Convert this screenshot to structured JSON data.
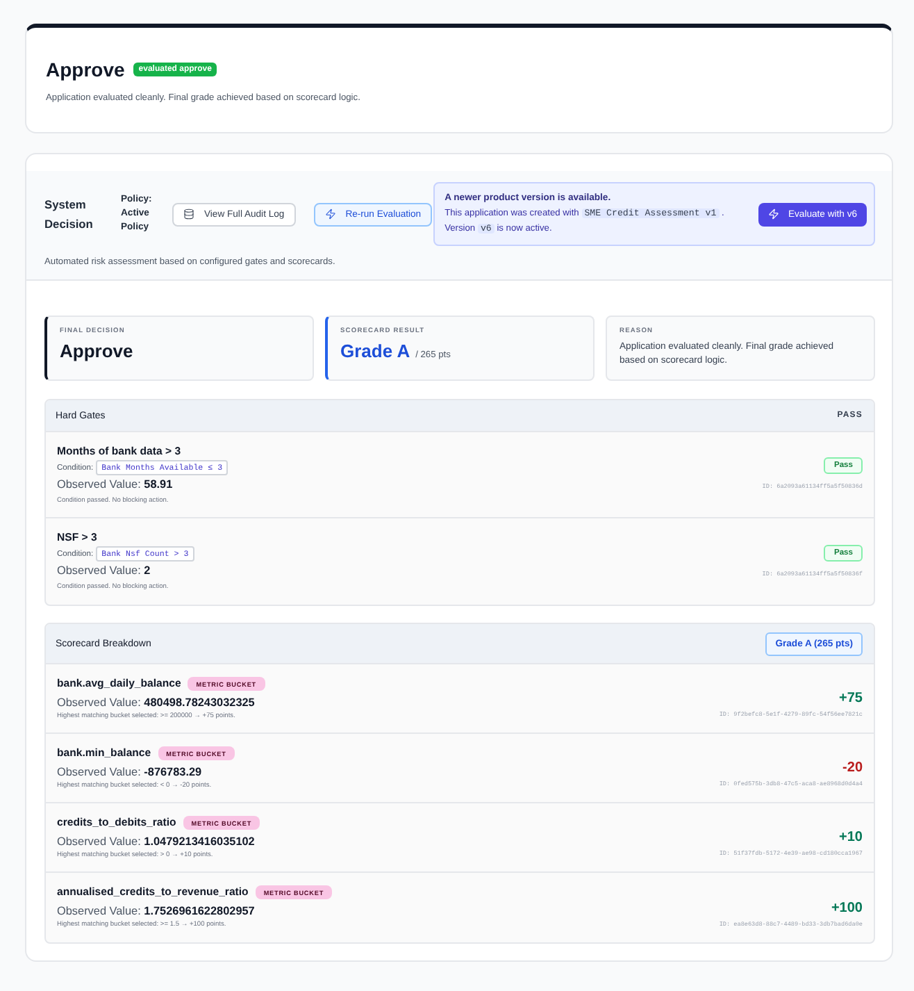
{
  "decision_card": {
    "title": "Approve",
    "badge": "evaluated approve",
    "summary": "Application evaluated cleanly. Final grade achieved based on scorecard logic."
  },
  "system_decision": {
    "title": "System Decision",
    "policy_label": "Policy:",
    "policy_name": "Active Policy",
    "buttons": [
      {
        "kind": "audit",
        "label": "View Full Audit Log"
      },
      {
        "kind": "rerun",
        "label": "Re-run Evaluation"
      }
    ],
    "version_notice": {
      "heading": "A newer product version is available.",
      "body": [
        {
          "kind": "text",
          "text": "This application was created with"
        },
        {
          "kind": "code",
          "text": "SME Credit Assessment v1"
        },
        {
          "kind": "text",
          "text": "."
        },
        {
          "kind": "text",
          "text": "Version"
        },
        {
          "kind": "code",
          "text": "v6"
        },
        {
          "kind": "text",
          "text": "is now active."
        }
      ],
      "button": "Evaluate with v6"
    },
    "description": "Automated risk assessment based on configured gates and scorecards."
  },
  "summary_cards": [
    {
      "kind": "decision",
      "label": "FINAL DECISION",
      "value": "Approve"
    },
    {
      "kind": "score",
      "label": "SCORECARD RESULT",
      "value": "Grade A",
      "suffix": "/ 265 pts"
    },
    {
      "kind": "reason",
      "label": "REASON",
      "text": "Application evaluated cleanly. Final grade achieved based on scorecard logic."
    }
  ],
  "hard_gates": {
    "title": "Hard Gates",
    "status": "PASS",
    "gates": [
      {
        "name": "Months of bank data > 3",
        "condition_label": "Condition:",
        "condition": "Bank Months Available ≤ 3",
        "observed_label": "Observed Value:",
        "observed": "58.91",
        "note": "Condition passed. No blocking action.",
        "result": "Pass",
        "id": "ID: 6a2093a61134ff5a5f50836d"
      },
      {
        "name": "NSF > 3",
        "condition_label": "Condition:",
        "condition": "Bank Nsf Count > 3",
        "observed_label": "Observed Value:",
        "observed": "2",
        "note": "Condition passed. No blocking action.",
        "result": "Pass",
        "id": "ID: 6a2093a61134ff5a5f50836f"
      }
    ]
  },
  "scorecard": {
    "title": "Scorecard Breakdown",
    "total": "Grade A (265 pts)",
    "metrics": [
      {
        "name": "bank.avg_daily_balance",
        "tag": "METRIC BUCKET",
        "observed_label": "Observed Value:",
        "observed": "480498.78243032325",
        "note": "Highest matching bucket selected: >= 200000 → +75 points.",
        "points": "+75",
        "color": "#047857",
        "id": "ID: 9f2befc8-5e1f-4279-89fc-54f56ee7821c"
      },
      {
        "name": "bank.min_balance",
        "tag": "METRIC BUCKET",
        "observed_label": "Observed Value:",
        "observed": "-876783.29",
        "note": "Highest matching bucket selected: < 0 → -20 points.",
        "points": "-20",
        "color": "#b91c1c",
        "id": "ID: 0fed575b-3db8-47c5-aca8-ae8968d0d4a4"
      },
      {
        "name": "credits_to_debits_ratio",
        "tag": "METRIC BUCKET",
        "observed_label": "Observed Value:",
        "observed": "1.0479213416035102",
        "note": "Highest matching bucket selected: > 0 → +10 points.",
        "points": "+10",
        "color": "#047857",
        "id": "ID: 51f37fdb-5172-4e39-ae98-cd180cca1967"
      },
      {
        "name": "annualised_credits_to_revenue_ratio",
        "tag": "METRIC BUCKET",
        "observed_label": "Observed Value:",
        "observed": "1.7526961622802957",
        "note": "Highest matching bucket selected: >= 1.5 → +100 points.",
        "points": "+100",
        "color": "#047857",
        "id": "ID: ea8e63d8-88c7-4489-bd33-3db7bad6da0e"
      }
    ]
  }
}
